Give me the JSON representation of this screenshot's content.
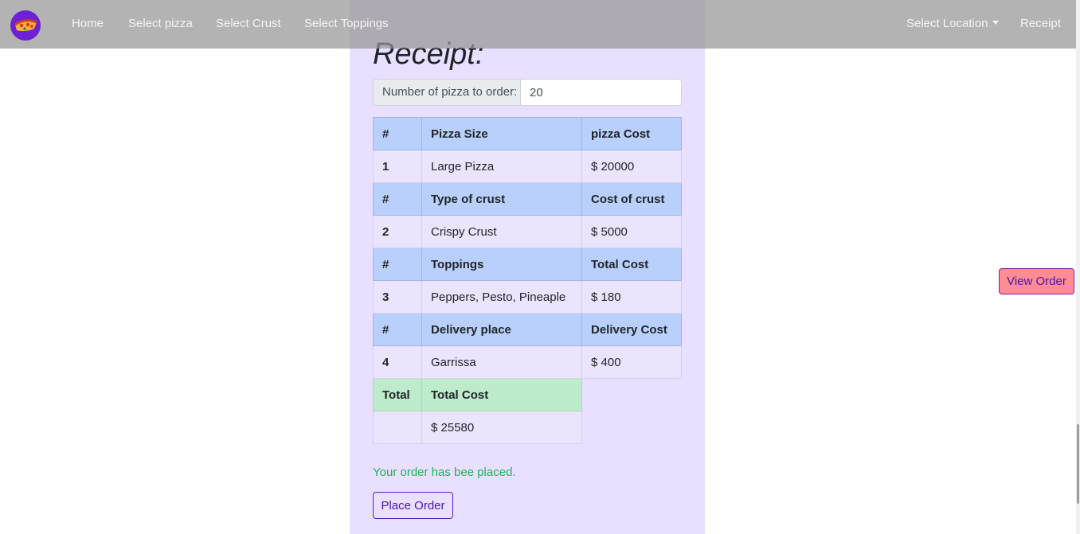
{
  "colors": {
    "navbar_bg": "#969696",
    "panel_bg": "#e9dfff",
    "table_header_bg": "#b8d0fb",
    "table_row_bg": "#ece3fd",
    "total_header_bg": "#bdebcb",
    "success_text": "#1fb455",
    "view_order_bg": "#ff8c94",
    "place_order_border": "#5a20b8"
  },
  "navbar": {
    "logo_icon": "pizza-logo-icon",
    "links": {
      "home": "Home",
      "select_pizza": "Select pizza",
      "select_crust": "Select Crust",
      "select_toppings": "Select Toppings",
      "select_location": "Select Location",
      "receipt": "Receipt"
    }
  },
  "receipt": {
    "title": "Receipt:",
    "quantity_label": "Number of pizza to order:",
    "quantity_value": "20",
    "sections": [
      {
        "header": [
          "#",
          "Pizza Size",
          "pizza Cost"
        ],
        "row": [
          "1",
          "Large Pizza",
          "$ 20000"
        ]
      },
      {
        "header": [
          "#",
          "Type of crust",
          "Cost of crust"
        ],
        "row": [
          "2",
          "Crispy Crust",
          "$ 5000"
        ]
      },
      {
        "header": [
          "#",
          "Toppings",
          "Total Cost"
        ],
        "row": [
          "3",
          "Peppers, Pesto, Pineaple",
          "$ 180"
        ]
      },
      {
        "header": [
          "#",
          "Delivery place",
          "Delivery Cost"
        ],
        "row": [
          "4",
          "Garrissa",
          "$ 400"
        ]
      }
    ],
    "total": {
      "header": [
        "Total",
        "Total Cost"
      ],
      "row": [
        "",
        "$ 25580"
      ]
    },
    "success_message": "Your order has bee placed.",
    "place_order_label": "Place Order"
  },
  "view_order_label": "View Order"
}
